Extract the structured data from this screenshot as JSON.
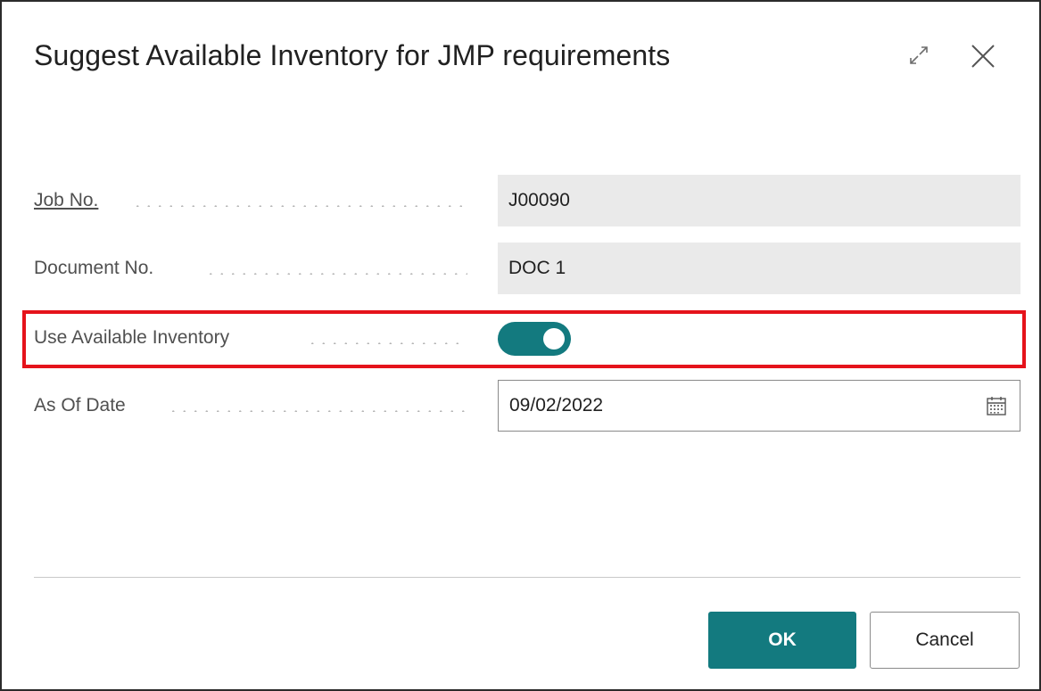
{
  "dialog": {
    "title": "Suggest Available Inventory for JMP requirements",
    "expand_icon": "expand-icon",
    "close_icon": "close-icon"
  },
  "fields": {
    "job_no": {
      "label": "Job No.",
      "value": "J00090"
    },
    "document_no": {
      "label": "Document No.",
      "value": "DOC 1"
    },
    "use_available_inventory": {
      "label": "Use Available Inventory",
      "checked": true
    },
    "as_of_date": {
      "label": "As Of Date",
      "value": "09/02/2022",
      "icon": "calendar-icon"
    }
  },
  "buttons": {
    "ok": "OK",
    "cancel": "Cancel"
  },
  "colors": {
    "accent": "#137a7f",
    "highlight": "#e5131b",
    "readonly_bg": "#eaeaea"
  }
}
